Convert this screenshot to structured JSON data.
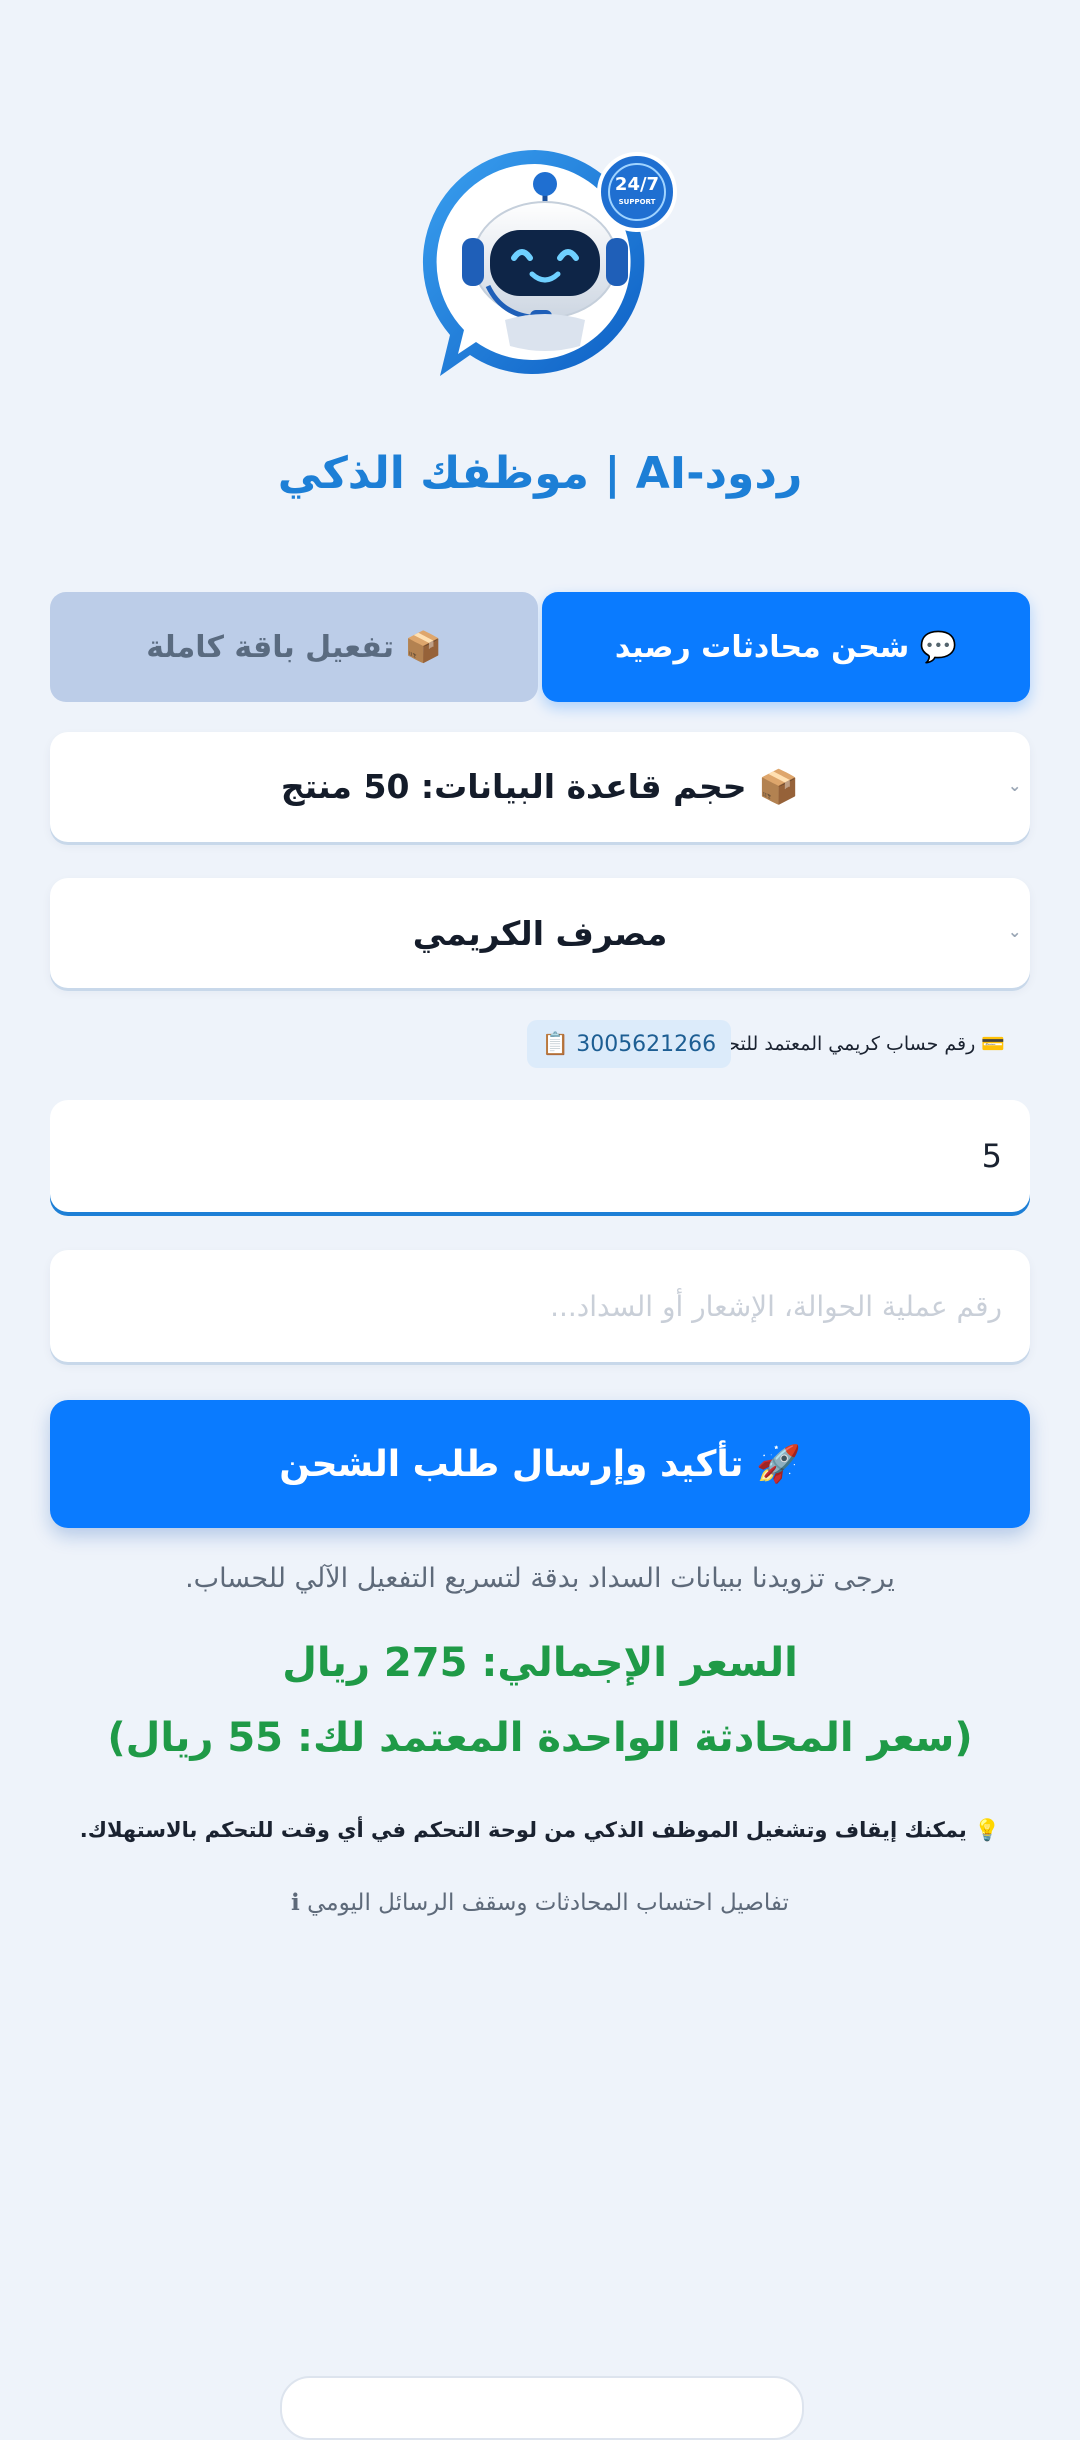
{
  "brand": {
    "logo_badge": "24/7",
    "logo_badge_sub": "SUPPORT",
    "title": "ردود-AI | موظفك الذكي"
  },
  "tabs": [
    {
      "label": "💬 شحن محادثات رصيد",
      "active": true
    },
    {
      "label": "📦 تفعيل باقة كاملة",
      "active": false
    }
  ],
  "form": {
    "package_select": "📦 حجم قاعدة البيانات: 50 منتج",
    "bank_select": "مصرف الكريمي",
    "account_label": "💳 رقم حساب كريمي المعتمد للتحويل:",
    "account_number": "📋 3005621266",
    "quantity_value": "5",
    "reference_placeholder": "رقم عملية الحوالة، الإشعار أو السداد...",
    "submit_label": "🚀 تأكيد وإرسال طلب الشحن"
  },
  "info": {
    "hint": "يرجى تزويدنا ببيانات السداد بدقة لتسريع التفعيل الآلي للحساب.",
    "total_price": "السعر الإجمالي: 275 ريال",
    "unit_price": "(سعر المحادثة الواحدة المعتمد لك: 55 ريال)",
    "tip": "💡 يمكنك إيقاف وتشغيل الموظف الذكي من لوحة التحكم في أي وقت للتحكم بالاستهلاك.",
    "details_link": "تفاصيل احتساب المحادثات وسقف الرسائل اليومي ℹ"
  },
  "colors": {
    "primary": "#0a7bff",
    "title": "#1d7fd6",
    "price": "#1f9a47",
    "background": "#eef3fa",
    "tab_inactive": "#bccde8"
  },
  "icons": [
    "chat-icon",
    "box-icon",
    "card-icon",
    "clipboard-icon",
    "rocket-icon",
    "lightbulb-icon",
    "info-icon",
    "chevron-down-icon",
    "robot-logo"
  ]
}
